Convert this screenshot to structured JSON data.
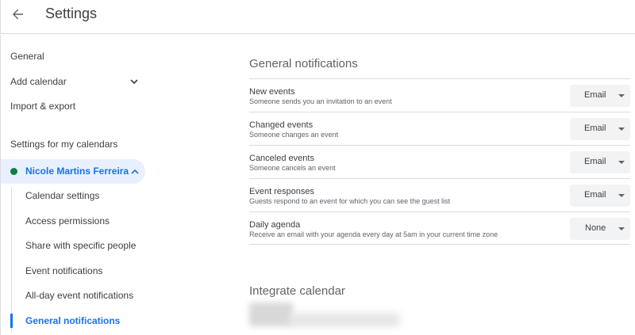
{
  "header": {
    "title": "Settings"
  },
  "sidebar": {
    "items": [
      {
        "label": "General"
      },
      {
        "label": "Add calendar"
      },
      {
        "label": "Import & export"
      }
    ],
    "section_label": "Settings for my calendars",
    "calendar": {
      "name": "Nicole Martins Ferreira",
      "color": "#0b8043"
    },
    "sub_items": [
      {
        "label": "Calendar settings"
      },
      {
        "label": "Access permissions"
      },
      {
        "label": "Share with specific people"
      },
      {
        "label": "Event notifications"
      },
      {
        "label": "All-day event notifications"
      },
      {
        "label": "General notifications"
      }
    ]
  },
  "main": {
    "section_title": "General notifications",
    "rows": [
      {
        "title": "New events",
        "desc": "Someone sends you an invitation to an event",
        "value": "Email"
      },
      {
        "title": "Changed events",
        "desc": "Someone changes an event",
        "value": "Email"
      },
      {
        "title": "Canceled events",
        "desc": "Someone cancels an event",
        "value": "Email"
      },
      {
        "title": "Event responses",
        "desc": "Guests respond to an event for which you can see the guest list",
        "value": "Email"
      },
      {
        "title": "Daily agenda",
        "desc": "Receive an email with your agenda every day at 5am in your current time zone",
        "value": "None"
      }
    ],
    "integrate_title": "Integrate calendar"
  },
  "colors": {
    "accent": "#1a73e8",
    "active_bg": "#e8f0fe"
  },
  "icons": {
    "back": "arrow-back-icon",
    "expand": "chevron-down-icon",
    "collapse": "chevron-up-icon"
  }
}
